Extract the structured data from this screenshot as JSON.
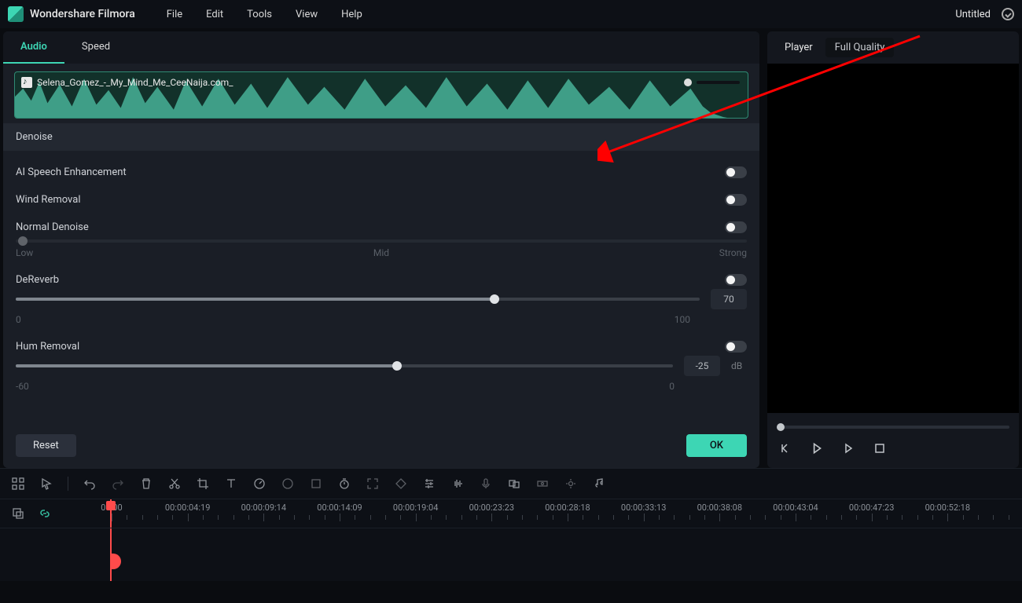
{
  "app": {
    "title": "Wondershare Filmora",
    "doc_title": "Untitled"
  },
  "menu": [
    "File",
    "Edit",
    "Tools",
    "View",
    "Help"
  ],
  "inspector": {
    "tabs": [
      "Audio",
      "Speed"
    ],
    "active_tab": "Audio",
    "clip_name": "Selena_Gomez_-_My_Mind_Me_CeeNaija.com_",
    "section": "Denoise",
    "ai_speech": {
      "label": "AI Speech Enhancement",
      "on": false
    },
    "wind": {
      "label": "Wind Removal",
      "on": false
    },
    "normal": {
      "label": "Normal Denoise",
      "on": false,
      "scale": [
        "Low",
        "Mid",
        "Strong"
      ]
    },
    "dereverb": {
      "label": "DeReverb",
      "on": false,
      "value": "70",
      "min": "0",
      "max": "100",
      "pct": 70
    },
    "hum": {
      "label": "Hum Removal",
      "on": false,
      "value": "-25",
      "unit": "dB",
      "min": "-60",
      "max": "0",
      "pct": 58
    },
    "reset": "Reset",
    "ok": "OK"
  },
  "player": {
    "tab_player": "Player",
    "tab_quality": "Full Quality"
  },
  "timeline": {
    "times": [
      "00:00",
      "00:00:04:19",
      "00:00:09:14",
      "00:00:14:09",
      "00:00:19:04",
      "00:00:23:23",
      "00:00:28:18",
      "00:00:33:13",
      "00:00:38:08",
      "00:00:43:04",
      "00:00:47:23",
      "00:00:52:18"
    ]
  }
}
